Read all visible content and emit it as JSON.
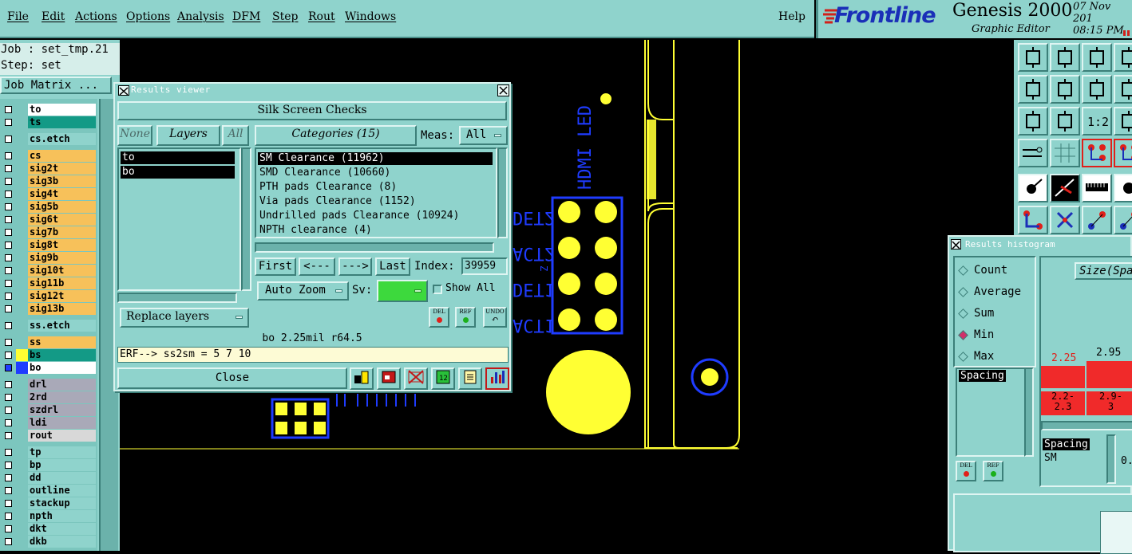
{
  "menu": {
    "items": [
      "File",
      "Edit",
      "Actions",
      "Options",
      "Analysis",
      "DFM",
      "Step",
      "Rout",
      "Windows"
    ],
    "help": "Help"
  },
  "brand": {
    "logo": "Frontline",
    "product": "Genesis 2000",
    "subtitle": "Graphic Editor",
    "date": "07 Nov 201",
    "time": "08:15 PM"
  },
  "job": {
    "job_label": "Job : set_tmp.21",
    "step_label": "Step: set",
    "matrix_label": "Job Matrix ..."
  },
  "layers": [
    {
      "name": "to",
      "color": "#ffffff"
    },
    {
      "name": "ts",
      "color": "#139a86"
    },
    {
      "name": "cs.etch",
      "color": "#8fd3cc"
    },
    {
      "name": "cs",
      "color": "#f7c15a"
    },
    {
      "name": "sig2t",
      "color": "#f7c15a"
    },
    {
      "name": "sig3b",
      "color": "#f7c15a"
    },
    {
      "name": "sig4t",
      "color": "#f7c15a"
    },
    {
      "name": "sig5b",
      "color": "#f7c15a"
    },
    {
      "name": "sig6t",
      "color": "#f7c15a"
    },
    {
      "name": "sig7b",
      "color": "#f7c15a"
    },
    {
      "name": "sig8t",
      "color": "#f7c15a"
    },
    {
      "name": "sig9b",
      "color": "#f7c15a"
    },
    {
      "name": "sig10t",
      "color": "#f7c15a"
    },
    {
      "name": "sig11b",
      "color": "#f7c15a"
    },
    {
      "name": "sig12t",
      "color": "#f7c15a"
    },
    {
      "name": "sig13b",
      "color": "#f7c15a"
    },
    {
      "name": "ss.etch",
      "color": "#8fd3cc"
    },
    {
      "name": "ss",
      "color": "#f7c15a"
    },
    {
      "name": "bs",
      "color": "#139a86"
    },
    {
      "name": "bo",
      "color": "#ffffff"
    },
    {
      "name": "drl",
      "color": "#a9a9b8"
    },
    {
      "name": "2rd",
      "color": "#a9a9b8"
    },
    {
      "name": "szdrl",
      "color": "#a9a9b8"
    },
    {
      "name": "ldi",
      "color": "#a9a9b8"
    },
    {
      "name": "rout",
      "color": "#d8d8d8"
    },
    {
      "name": "tp",
      "color": "#8fd3cc"
    },
    {
      "name": "bp",
      "color": "#8fd3cc"
    },
    {
      "name": "dd",
      "color": "#8fd3cc"
    },
    {
      "name": "outline",
      "color": "#8fd3cc"
    },
    {
      "name": "stackup",
      "color": "#8fd3cc"
    },
    {
      "name": "npth",
      "color": "#8fd3cc"
    },
    {
      "name": "dkt",
      "color": "#8fd3cc"
    },
    {
      "name": "dkb",
      "color": "#8fd3cc"
    }
  ],
  "results_viewer": {
    "title": "Results viewer",
    "section": "Silk Screen Checks",
    "none_btn": "None",
    "layers_btn": "Layers",
    "all_btn": "All",
    "layer_list": [
      "to",
      "bo"
    ],
    "categories_btn": "Categories (15)",
    "meas_label": "Meas:",
    "meas_value": "All",
    "categories": [
      "SM Clearance (11962)",
      "SMD Clearance (10660)",
      "PTH pads Clearance (8)",
      "Via pads Clearance (1152)",
      "Undrilled pads Clearance (10924)",
      "NPTH clearance (4)"
    ],
    "first": "First",
    "prev": "<---",
    "next": "--->",
    "last": "Last",
    "index_label": "Index:",
    "index_value": "39959",
    "autozoom": "Auto Zoom",
    "sv_label": "Sv:",
    "show_all": "Show All",
    "replace_layers": "Replace layers",
    "del": "DEL",
    "ref": "REF",
    "undo": "UNDO",
    "status": "bo 2.25mil  r64.5",
    "erf": "ERF--> ss2sm = 5 7 10",
    "close": "Close"
  },
  "histogram": {
    "title": "Results histogram",
    "options": [
      "Count",
      "Average",
      "Sum",
      "Min",
      "Max"
    ],
    "selected": "Min",
    "size_btn": "Size(Spa",
    "bars": [
      {
        "value": "2.25",
        "range": "2.2-\n2.3"
      },
      {
        "value": "2.95",
        "range": "2.9-\n3"
      }
    ],
    "list_top": "Spacing",
    "list_bottom": [
      "Spacing",
      "SM"
    ],
    "tail": "0.",
    "del": "DEL",
    "ref": "REF"
  },
  "pcb": {
    "silk_text": "HDMI LED",
    "side_labels": [
      "DET2",
      "ACT2",
      "DET1",
      "ACT1"
    ],
    "small_labels": [
      "Z"
    ]
  }
}
